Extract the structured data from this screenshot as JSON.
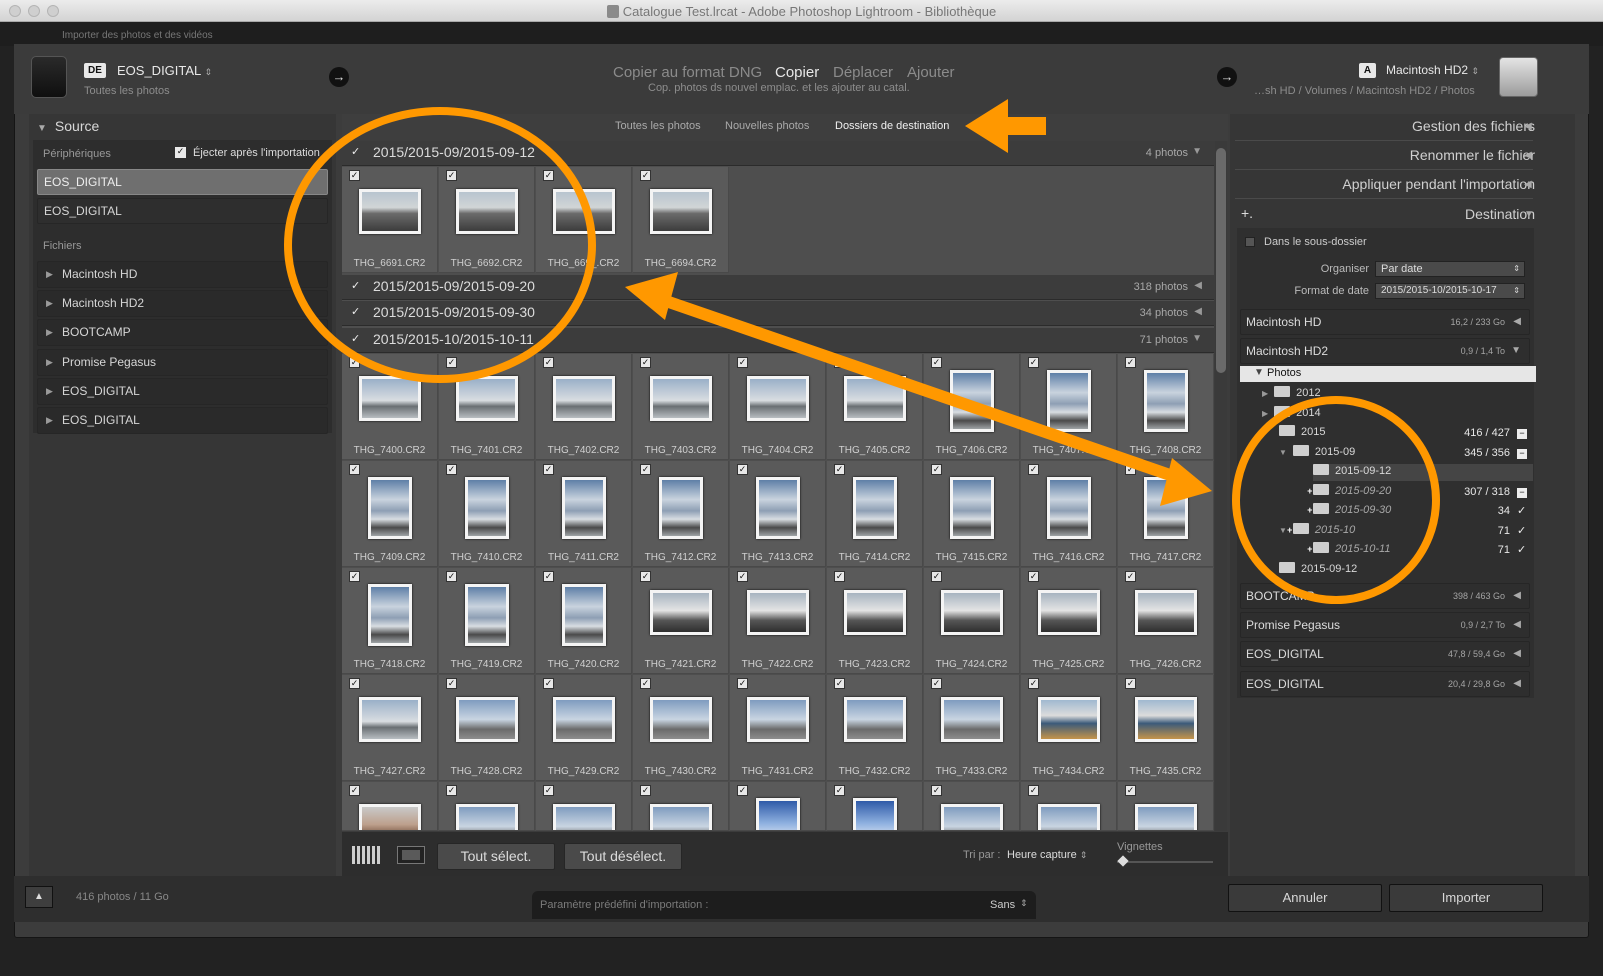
{
  "window": {
    "title": "Catalogue Test.lrcat - Adobe Photoshop Lightroom - Bibliothèque",
    "import_title": "Importer des photos et des vidéos"
  },
  "header": {
    "source_badge": "DE",
    "source_name": "EOS_DIGITAL",
    "source_sub": "Toutes les photos",
    "modes": [
      "Copier au format DNG",
      "Copier",
      "Déplacer",
      "Ajouter"
    ],
    "active_mode": "Copier",
    "mode_desc": "Cop. photos ds nouvel emplac. et les ajouter au catal.",
    "dest_badge": "A",
    "dest_name": "Macintosh HD2",
    "dest_path": "…sh HD / Volumes / Macintosh HD2 / Photos"
  },
  "source_panel": {
    "title": "Source",
    "devices_label": "Périphériques",
    "eject_label": "Éjecter après l'importation",
    "eject_checked": true,
    "devices": [
      "EOS_DIGITAL",
      "EOS_DIGITAL"
    ],
    "selected_device": "EOS_DIGITAL",
    "files_label": "Fichiers",
    "volumes": [
      "Macintosh HD",
      "Macintosh HD2",
      "BOOTCAMP",
      "Promise Pegasus",
      "EOS_DIGITAL",
      "EOS_DIGITAL"
    ]
  },
  "view_tabs": [
    "Toutes les photos",
    "Nouvelles photos",
    "Dossiers de destination"
  ],
  "active_view_tab": "Dossiers de destination",
  "folders": [
    {
      "name": "2015/2015-09/2015-09-12",
      "count": "4 photos",
      "expanded": true
    },
    {
      "name": "2015/2015-09/2015-09-20",
      "count": "318 photos",
      "expanded": false
    },
    {
      "name": "2015/2015-09/2015-09-30",
      "count": "34 photos",
      "expanded": false
    },
    {
      "name": "2015/2015-10/2015-10-11",
      "count": "71 photos",
      "expanded": true
    }
  ],
  "group1_photos": [
    {
      "name": "THG_6691.CR2",
      "img": "street",
      "o": "land"
    },
    {
      "name": "THG_6692.CR2",
      "img": "street",
      "o": "land"
    },
    {
      "name": "THG_669_.CR2",
      "img": "street",
      "o": "land"
    },
    {
      "name": "THG_6694.CR2",
      "img": "street",
      "o": "land"
    }
  ],
  "group4_photos": [
    {
      "name": "THG_7400.CR2",
      "img": "sky",
      "o": "land"
    },
    {
      "name": "THG_7401.CR2",
      "img": "sky",
      "o": "land"
    },
    {
      "name": "THG_7402.CR2",
      "img": "sky",
      "o": "land"
    },
    {
      "name": "THG_7403.CR2",
      "img": "sky",
      "o": "land"
    },
    {
      "name": "THG_7404.CR2",
      "img": "sky",
      "o": "land"
    },
    {
      "name": "THG_7405.CR2",
      "img": "sky",
      "o": "land"
    },
    {
      "name": "THG_7406.CR2",
      "img": "cloud",
      "o": "port"
    },
    {
      "name": "THG_7407.CR2",
      "img": "cloud",
      "o": "port"
    },
    {
      "name": "THG_7408.CR2",
      "img": "cloud",
      "o": "port"
    },
    {
      "name": "THG_7409.CR2",
      "img": "cloud",
      "o": "port"
    },
    {
      "name": "THG_7410.CR2",
      "img": "cloud",
      "o": "port"
    },
    {
      "name": "THG_7411.CR2",
      "img": "cloud",
      "o": "port"
    },
    {
      "name": "THG_7412.CR2",
      "img": "cloud",
      "o": "port"
    },
    {
      "name": "THG_7413.CR2",
      "img": "cloud",
      "o": "port"
    },
    {
      "name": "THG_7414.CR2",
      "img": "cloud",
      "o": "port"
    },
    {
      "name": "THG_7415.CR2",
      "img": "cloud",
      "o": "port"
    },
    {
      "name": "THG_7416.CR2",
      "img": "cloud",
      "o": "port"
    },
    {
      "name": "THG_7417.CR2",
      "img": "cloud",
      "o": "port"
    },
    {
      "name": "THG_7418.CR2",
      "img": "cloud",
      "o": "port"
    },
    {
      "name": "THG_7419.CR2",
      "img": "cloud",
      "o": "port"
    },
    {
      "name": "THG_7420.CR2",
      "img": "cloud",
      "o": "port"
    },
    {
      "name": "THG_7421.CR2",
      "img": "dark",
      "o": "land"
    },
    {
      "name": "THG_7422.CR2",
      "img": "dark",
      "o": "land"
    },
    {
      "name": "THG_7423.CR2",
      "img": "dark",
      "o": "land"
    },
    {
      "name": "THG_7424.CR2",
      "img": "dark",
      "o": "land"
    },
    {
      "name": "THG_7425.CR2",
      "img": "dark",
      "o": "land"
    },
    {
      "name": "THG_7426.CR2",
      "img": "dark",
      "o": "land"
    },
    {
      "name": "THG_7427.CR2",
      "img": "sky",
      "o": "land"
    },
    {
      "name": "THG_7428.CR2",
      "img": "harbor",
      "o": "land"
    },
    {
      "name": "THG_7429.CR2",
      "img": "harbor",
      "o": "land"
    },
    {
      "name": "THG_7430.CR2",
      "img": "harbor",
      "o": "land"
    },
    {
      "name": "THG_7431.CR2",
      "img": "harbor",
      "o": "land"
    },
    {
      "name": "THG_7432.CR2",
      "img": "harbor",
      "o": "land"
    },
    {
      "name": "THG_7433.CR2",
      "img": "harbor",
      "o": "land"
    },
    {
      "name": "THG_7434.CR2",
      "img": "beach",
      "o": "land"
    },
    {
      "name": "THG_7435.CR2",
      "img": "beach",
      "o": "land"
    },
    {
      "name": "",
      "img": "people",
      "o": "land"
    },
    {
      "name": "",
      "img": "harbor",
      "o": "land"
    },
    {
      "name": "",
      "img": "harbor",
      "o": "land"
    },
    {
      "name": "",
      "img": "harbor",
      "o": "land"
    },
    {
      "name": "",
      "img": "blue",
      "o": "port"
    },
    {
      "name": "",
      "img": "blue",
      "o": "port"
    },
    {
      "name": "",
      "img": "harbor",
      "o": "land"
    },
    {
      "name": "",
      "img": "harbor",
      "o": "land"
    },
    {
      "name": "",
      "img": "harbor",
      "o": "land"
    }
  ],
  "toolbar": {
    "select_all": "Tout sélect.",
    "deselect_all": "Tout désélect.",
    "sort_label": "Tri par :",
    "sort_value": "Heure capture",
    "thumbs_label": "Vignettes"
  },
  "right_panel": {
    "sections": [
      "Gestion des fichiers",
      "Renommer le fichier",
      "Appliquer pendant l'importation",
      "Destination"
    ],
    "subfolder_label": "Dans le sous-dossier",
    "organize_label": "Organiser",
    "organize_value": "Par date",
    "date_format_label": "Format de date",
    "date_format_value": "2015/2015-10/2015-10-17",
    "volumes_top": [
      {
        "name": "Macintosh HD",
        "size": "16,2 / 233 Go"
      },
      {
        "name": "Macintosh HD2",
        "size": "0,9 / 1,4 To"
      }
    ],
    "photos_folder": "Photos",
    "tree": [
      {
        "label": "2012",
        "count": ""
      },
      {
        "label": "2014",
        "count": ""
      },
      {
        "label": "2015",
        "count": "416 / 427"
      },
      {
        "label": "2015-09",
        "count": "345 / 356"
      },
      {
        "label": "2015-09-12",
        "count": ""
      },
      {
        "label": "2015-09-20",
        "count": "307 / 318"
      },
      {
        "label": "2015-09-30",
        "count": "34"
      },
      {
        "label": "2015-10",
        "count": "71"
      },
      {
        "label": "2015-10-11",
        "count": "71"
      },
      {
        "label": "2015-09-12",
        "count": ""
      }
    ],
    "volumes_bottom": [
      {
        "name": "BOOTCAMP",
        "size": "398 / 463 Go"
      },
      {
        "name": "Promise Pegasus",
        "size": "0,9 / 2,7 To"
      },
      {
        "name": "EOS_DIGITAL",
        "size": "47,8 / 59,4 Go"
      },
      {
        "name": "EOS_DIGITAL",
        "size": "20,4 / 29,8 Go"
      }
    ]
  },
  "footer": {
    "status": "416 photos / 11 Go",
    "preset_label": "Paramètre prédéfini d'importation :",
    "preset_value": "Sans",
    "cancel": "Annuler",
    "import": "Importer"
  },
  "colors": {
    "annotation": "#ff9800",
    "selected_folder": "#e6e6e6"
  }
}
